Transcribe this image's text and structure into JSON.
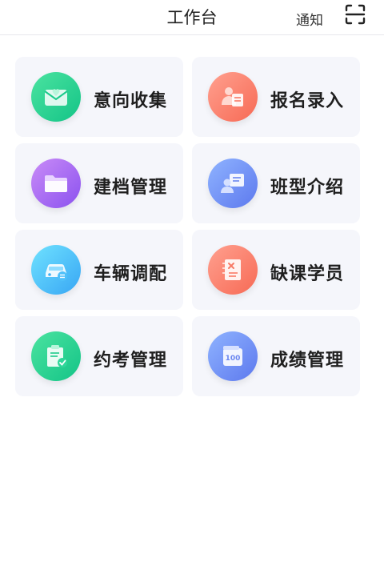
{
  "header": {
    "title": "工作台",
    "notice_label": "通知",
    "scan_icon": "scan-icon"
  },
  "tiles": [
    {
      "label": "意向收集",
      "icon": "mail-heart-icon",
      "color": "#1ccb8b"
    },
    {
      "label": "报名录入",
      "icon": "person-form-icon",
      "color": "#f87a66"
    },
    {
      "label": "建档管理",
      "icon": "folder-icon",
      "color": "#9a5ff2"
    },
    {
      "label": "班型介绍",
      "icon": "person-board-icon",
      "color": "#6a86f0"
    },
    {
      "label": "车辆调配",
      "icon": "car-icon",
      "color": "#3fb0f6"
    },
    {
      "label": "缺课学员",
      "icon": "notebook-x-icon",
      "color": "#f87a66"
    },
    {
      "label": "约考管理",
      "icon": "clipboard-check-icon",
      "color": "#1ccb8b"
    },
    {
      "label": "成绩管理",
      "icon": "score-100-icon",
      "color": "#6a86f0"
    }
  ]
}
